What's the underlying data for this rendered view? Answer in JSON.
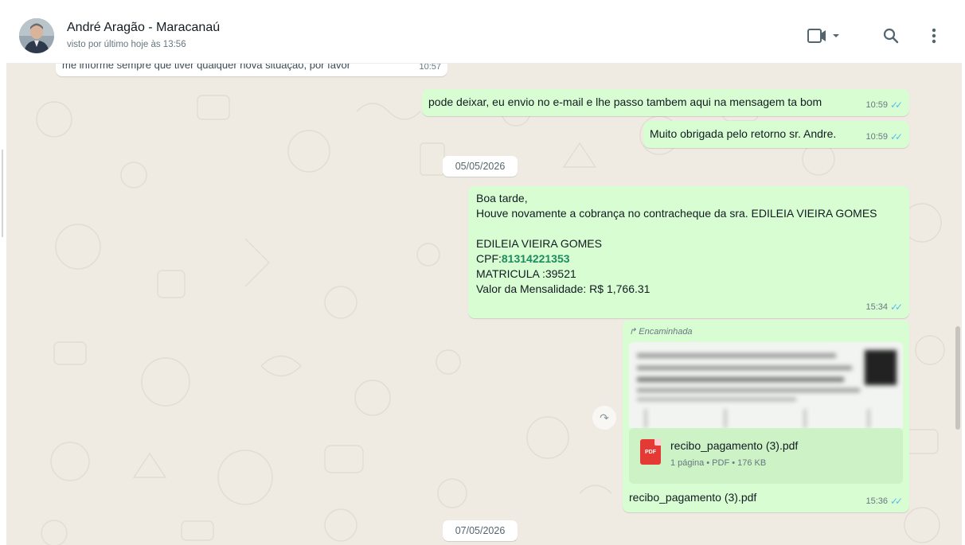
{
  "header": {
    "contact_name": "André Aragão - Maracanaú",
    "status": "visto por último hoje às 13:56",
    "icons": {
      "video": "video-call-icon",
      "search": "search-icon",
      "menu": "menu-icon"
    }
  },
  "messages": {
    "partial_incoming": {
      "text": "me informe sempre que tiver qualquer nova situação, por favor",
      "time": "10:57"
    },
    "msg1": {
      "text": "pode deixar, eu envio no e-mail e lhe passo tambem aqui na mensagem ta bom",
      "time": "10:59"
    },
    "msg2": {
      "text": "Muito obrigada pelo retorno sr. Andre.",
      "time": "10:59"
    },
    "date1": "05/05/2026",
    "msg3": {
      "line1": "Boa tarde,",
      "line2": "Houve novamente a cobrança no contracheque da sra. EDILEIA VIEIRA GOMES",
      "line3": "EDILEIA VIEIRA GOMES",
      "cpf_label": "CPF:",
      "cpf_number": "81314221353",
      "matricula": "MATRICULA :39521",
      "valor": "Valor da Mensalidade:  R$ 1,766.31",
      "time": "15:34"
    },
    "msg4": {
      "forwarded_label": "Encaminhada",
      "file_name": "recibo_pagamento (3).pdf",
      "file_meta": "1 página • PDF • 176 KB",
      "pdf_badge": "PDF",
      "caption": "recibo_pagamento (3).pdf",
      "time": "15:36"
    },
    "date2": "07/05/2026"
  },
  "colors": {
    "outgoing_bubble": "#d9fdd3",
    "incoming_bubble": "#ffffff",
    "chat_background": "#efeae2",
    "read_ticks": "#53bdeb",
    "cpf_link": "#1d8c60"
  }
}
